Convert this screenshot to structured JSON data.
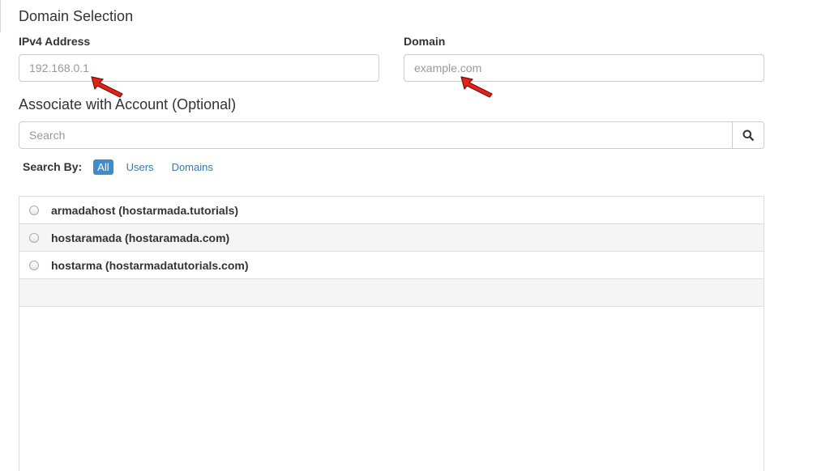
{
  "section": {
    "title": "Domain Selection"
  },
  "ipv4": {
    "label": "IPv4 Address",
    "placeholder": "192.168.0.1",
    "value": ""
  },
  "domain": {
    "label": "Domain",
    "placeholder": "example.com",
    "value": ""
  },
  "associate": {
    "title": "Associate with Account (Optional)",
    "search_placeholder": "Search",
    "search_icon": "magnifier-icon"
  },
  "search_by": {
    "label": "Search By:",
    "options": [
      "All",
      "Users",
      "Domains"
    ],
    "selected": "All"
  },
  "accounts": [
    {
      "label": "armadahost (hostarmada.tutorials)"
    },
    {
      "label": "hostaramada (hostaramada.com)"
    },
    {
      "label": "hostarma (hostarmadatutorials.com)"
    }
  ],
  "colors": {
    "accent": "#428bca",
    "link": "#337ab7",
    "annotation_arrow": "#e2231a"
  }
}
